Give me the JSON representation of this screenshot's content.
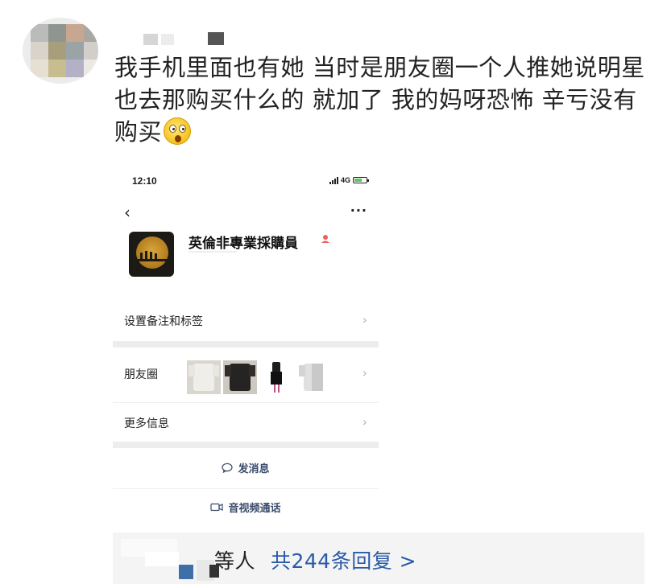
{
  "comment": {
    "text": "我手机里面也有她 当时是朋友圈一个人推她说明星也去那购买什么的 就加了 我的妈呀恐怖 辛亏没有购买",
    "emoji": "astonished-face"
  },
  "embedded_screenshot": {
    "status_bar": {
      "time": "12:10",
      "network": "4G"
    },
    "nav": {
      "back_icon": "chevron-left-icon",
      "more_icon": "ellipsis-icon"
    },
    "profile": {
      "name": "英倫非專業採購員",
      "badge_icon": "person-badge-icon"
    },
    "rows": {
      "remark_label": "设置备注和标签",
      "moments_label": "朋友圈",
      "more_info_label": "更多信息"
    },
    "actions": {
      "message_label": "发消息",
      "call_label": "音视频通话"
    }
  },
  "replies": {
    "prefix": "等人",
    "link": "共244条回复 >"
  }
}
